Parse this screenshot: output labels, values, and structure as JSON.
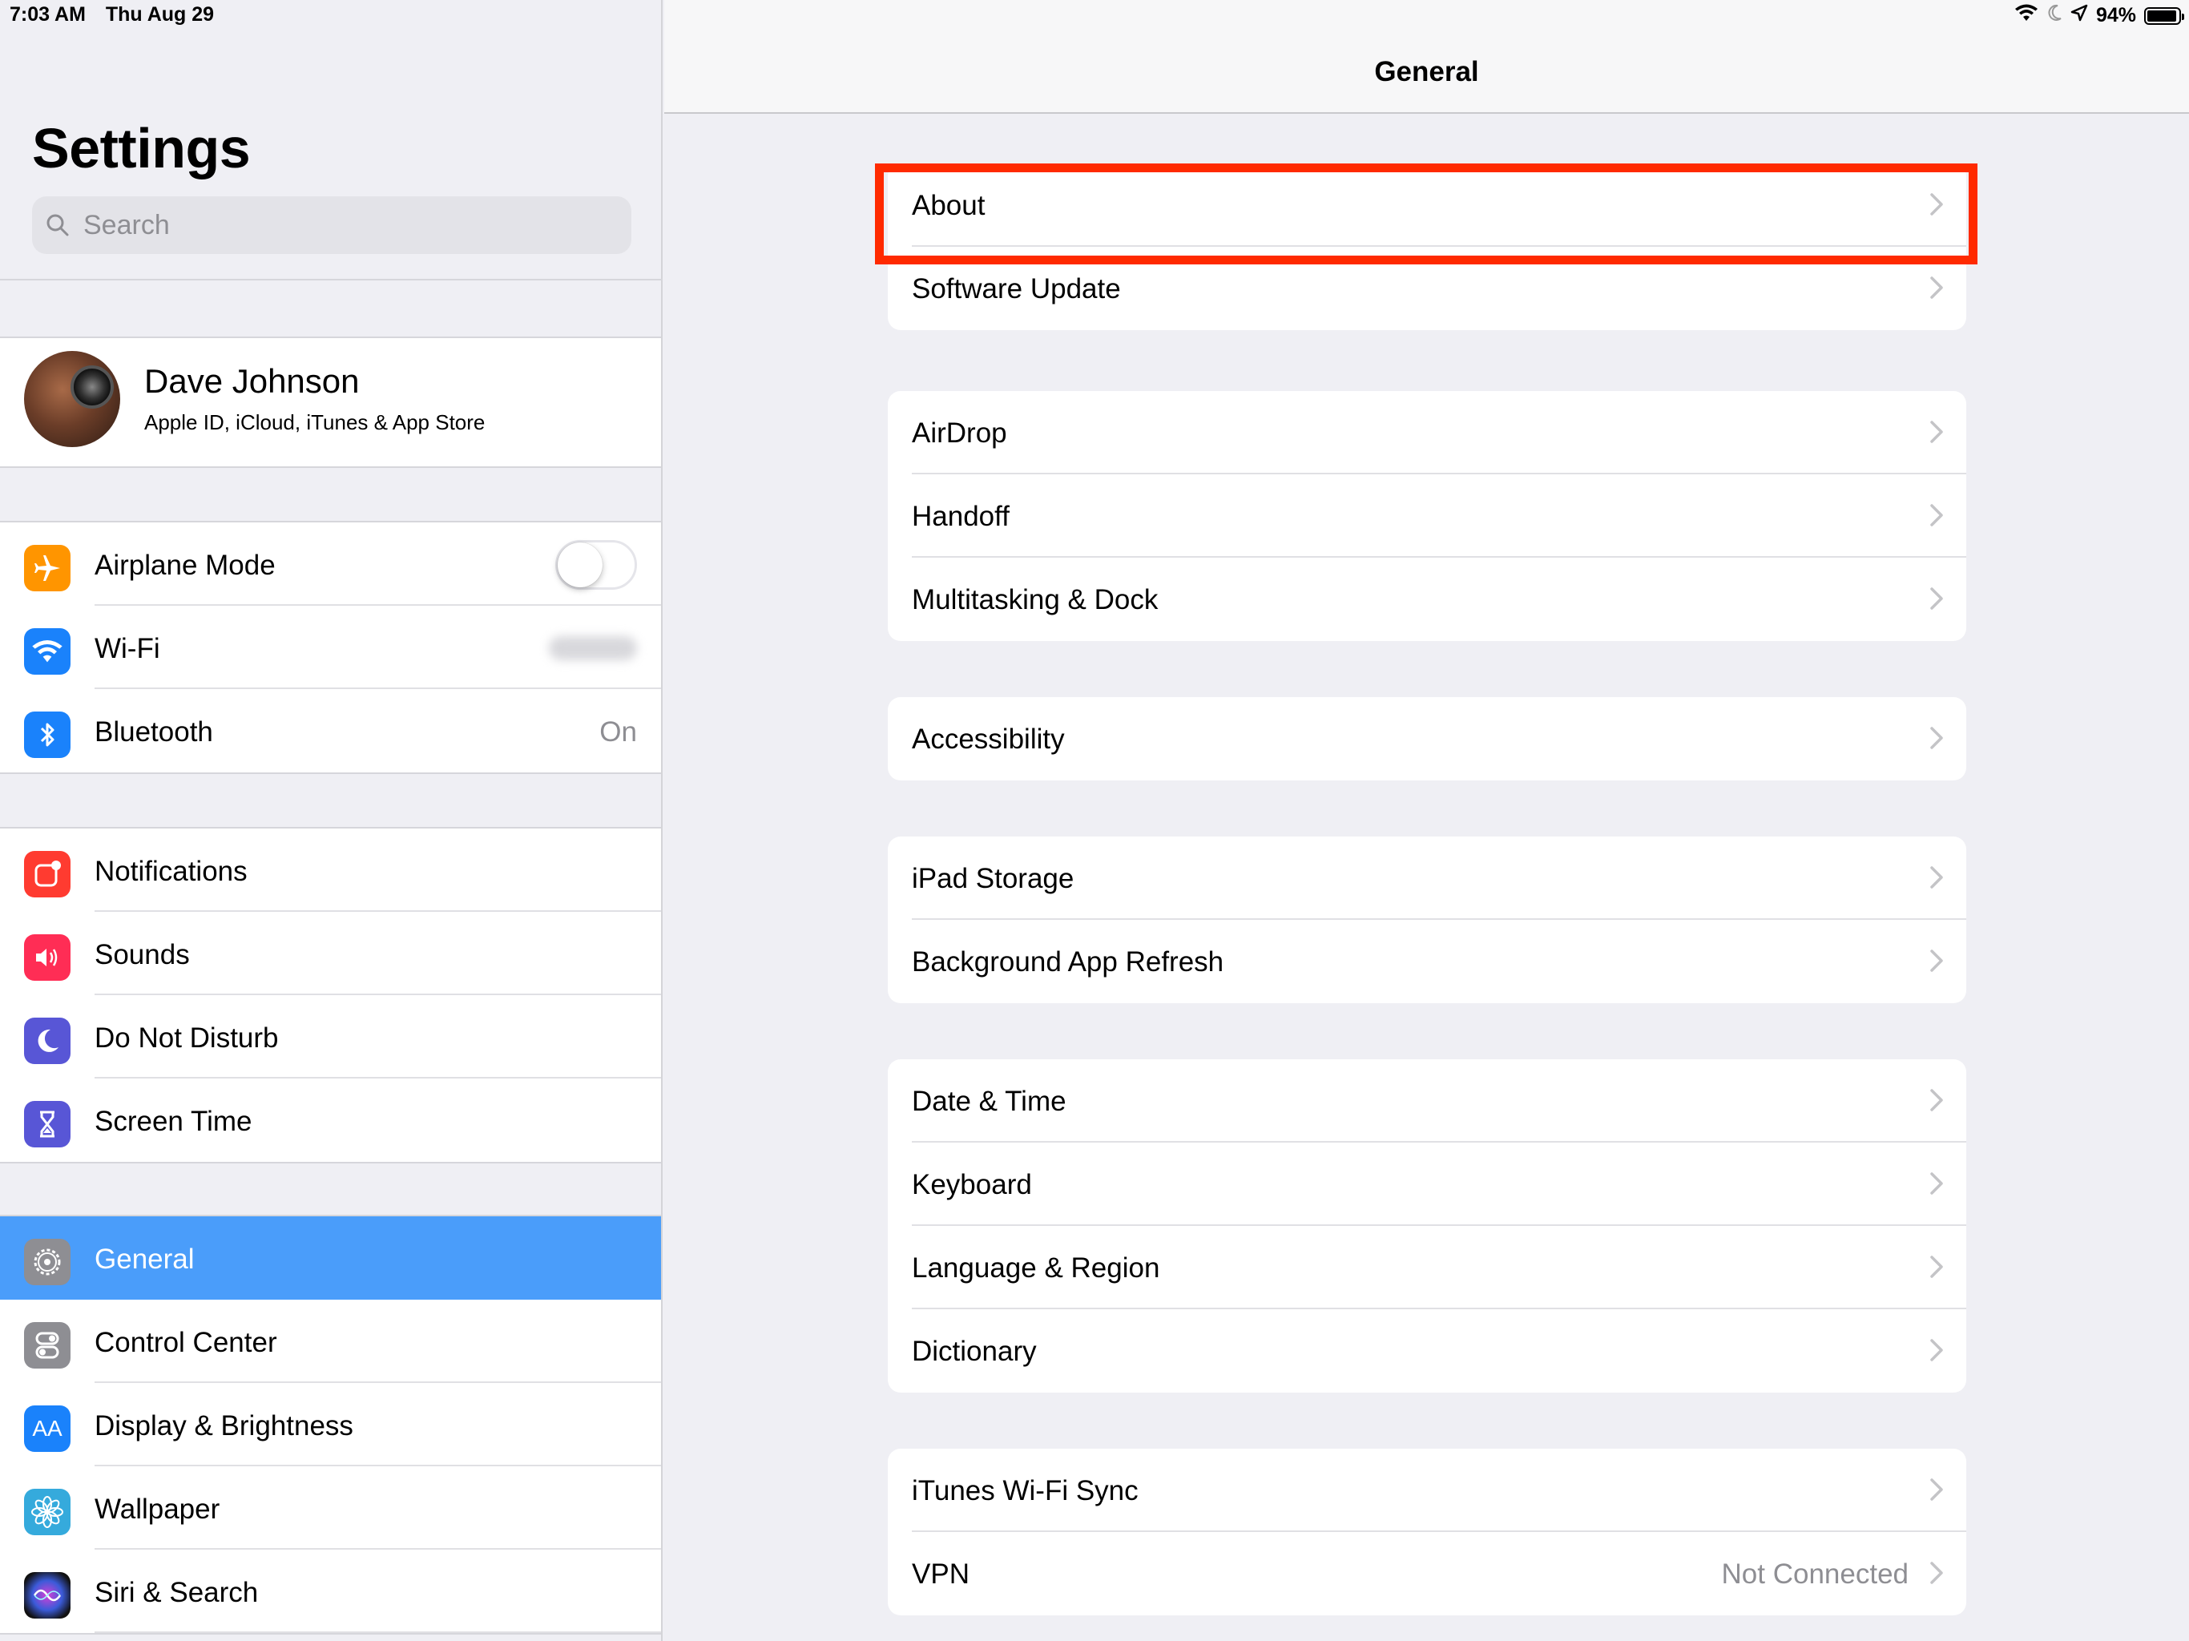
{
  "status_bar": {
    "time": "7:03 AM",
    "date": "Thu Aug 29",
    "battery": "94%",
    "battery_level": 0.94
  },
  "sidebar": {
    "title": "Settings",
    "search_placeholder": "Search",
    "profile": {
      "name": "Dave Johnson",
      "subtitle": "Apple ID, iCloud, iTunes & App Store"
    },
    "group1": [
      {
        "label": "Airplane Mode",
        "icon": "airplane-icon",
        "color": "#ff9500"
      },
      {
        "label": "Wi-Fi",
        "icon": "wifi-icon",
        "color": "#1a82fb"
      },
      {
        "label": "Bluetooth",
        "icon": "bluetooth-icon",
        "color": "#1a82fb",
        "value": "On"
      }
    ],
    "group2": [
      {
        "label": "Notifications",
        "icon": "notifications-icon",
        "color": "#ff3b30"
      },
      {
        "label": "Sounds",
        "icon": "sounds-icon",
        "color": "#ff2d55"
      },
      {
        "label": "Do Not Disturb",
        "icon": "moon-icon",
        "color": "#5856d6"
      },
      {
        "label": "Screen Time",
        "icon": "hourglass-icon",
        "color": "#5856d6"
      }
    ],
    "group3": [
      {
        "label": "General",
        "icon": "gear-icon",
        "color": "#8e8e93"
      },
      {
        "label": "Control Center",
        "icon": "control-center-icon",
        "color": "#8e8e93"
      },
      {
        "label": "Display & Brightness",
        "icon": "display-icon",
        "color": "#1a82fb",
        "glyph": "AA"
      },
      {
        "label": "Wallpaper",
        "icon": "flower-icon",
        "color": "#35aadc"
      },
      {
        "label": "Siri & Search",
        "icon": "siri-icon",
        "color": "#222"
      }
    ]
  },
  "detail": {
    "title": "General",
    "groups": [
      [
        {
          "label": "About"
        },
        {
          "label": "Software Update"
        }
      ],
      [
        {
          "label": "AirDrop"
        },
        {
          "label": "Handoff"
        },
        {
          "label": "Multitasking & Dock"
        }
      ],
      [
        {
          "label": "Accessibility"
        }
      ],
      [
        {
          "label": "iPad Storage"
        },
        {
          "label": "Background App Refresh"
        }
      ],
      [
        {
          "label": "Date & Time"
        },
        {
          "label": "Keyboard"
        },
        {
          "label": "Language & Region"
        },
        {
          "label": "Dictionary"
        }
      ],
      [
        {
          "label": "iTunes Wi-Fi Sync"
        },
        {
          "label": "VPN",
          "value": "Not Connected"
        }
      ]
    ]
  }
}
